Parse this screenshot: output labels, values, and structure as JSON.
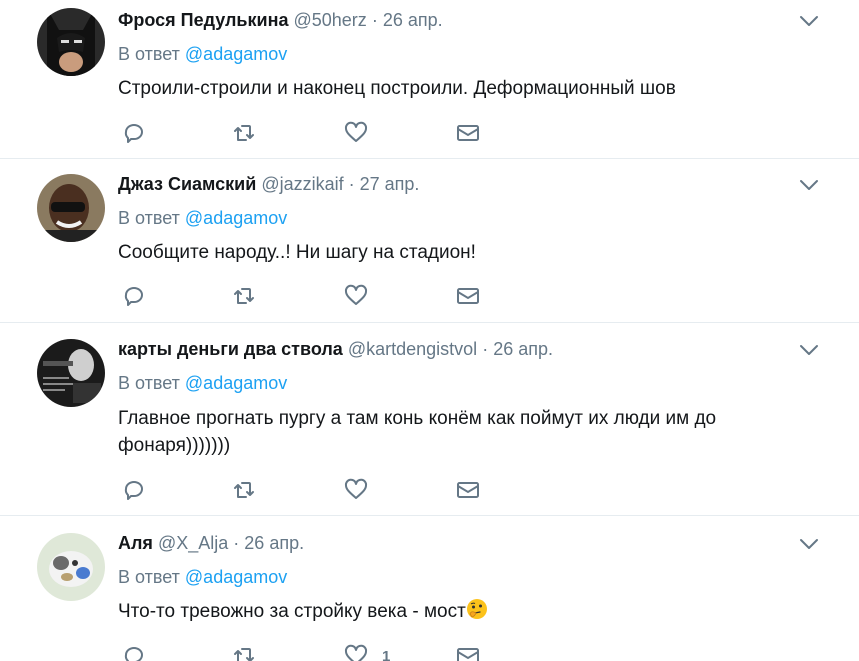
{
  "reply_prefix": "В ответ",
  "icons": {
    "reply": "reply-icon",
    "retweet": "retweet-icon",
    "like": "heart-icon",
    "dm": "envelope-icon",
    "menu": "chevron-down-icon"
  },
  "colors": {
    "accent": "#1da1f2",
    "secondary": "#657786",
    "divider": "#e6ecf0"
  },
  "tweets": [
    {
      "name": "Фрося Педулькина",
      "handle": "@50herz",
      "dot": "·",
      "date": "26 апр.",
      "reply_to": "@adagamov",
      "text": "Строили-строили и наконец построили. Деформационный шов",
      "likes": ""
    },
    {
      "name": "Джаз Сиамский",
      "handle": "@jazzikaif",
      "dot": "·",
      "date": "27 апр.",
      "reply_to": "@adagamov",
      "text": "Сообщите народу..! Ни шагу на стадион!",
      "likes": ""
    },
    {
      "name": "карты деньги два ствола",
      "handle": "@kartdengistvol",
      "dot": "·",
      "date": "26 апр.",
      "reply_to": "@adagamov",
      "text": "Главное прогнать пургу а там конь конём как поймут их люди им до фонаря)))))))",
      "likes": ""
    },
    {
      "name": "Аля",
      "handle": "@X_Alja",
      "dot": "·",
      "date": "26 апр.",
      "reply_to": "@adagamov",
      "text": "Что-то тревожно за стройку века - мост",
      "emoji": "thinking-face-emoji",
      "likes": "1"
    }
  ]
}
